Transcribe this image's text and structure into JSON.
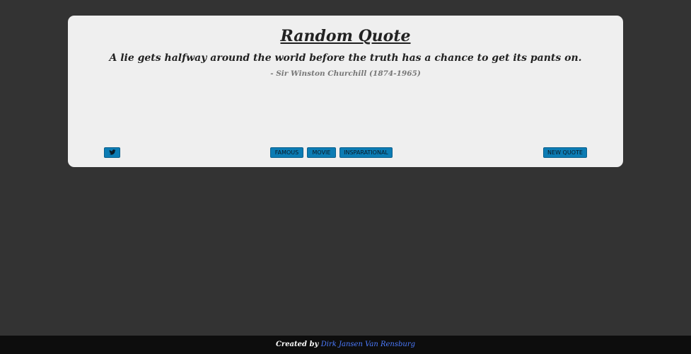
{
  "card": {
    "title": "Random Quote",
    "quote": "A lie gets halfway around the world before the truth has a chance to get its pants on.",
    "author": "- Sir Winston Churchill (1874-1965)"
  },
  "buttons": {
    "tweet_icon": "twitter-icon",
    "famous": "FAMOUS",
    "movie": "MOVIE",
    "inspirational": "INSPARATIONAL",
    "new_quote": "NEW QUOTE"
  },
  "footer": {
    "prefix": "Created by",
    "author_link": "Dirk Jansen Van Rensburg"
  },
  "colors": {
    "background": "#333333",
    "card": "#efefef",
    "button": "#0c7cb4",
    "footer": "#0d0d0d",
    "link": "#4c7bff"
  }
}
